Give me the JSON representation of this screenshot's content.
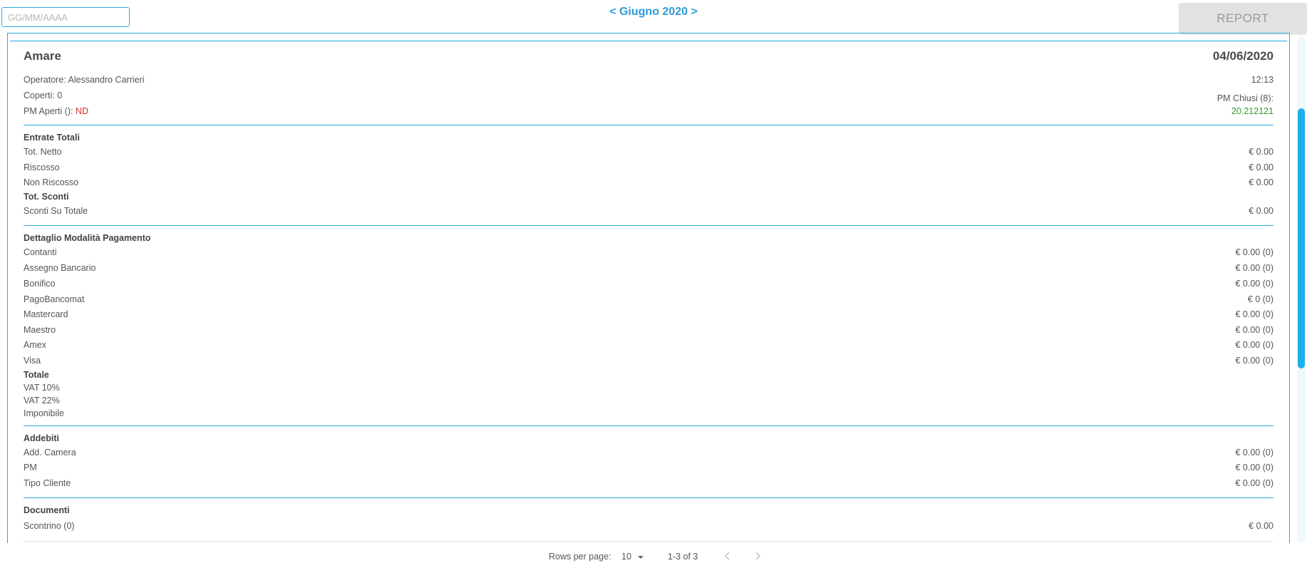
{
  "toolbar": {
    "date_placeholder": "GG/MM/AAAA",
    "month_label": "< Giugno 2020 >",
    "report_label": "REPORT"
  },
  "header": {
    "title": "Amare",
    "date": "04/06/2020",
    "operator_label": "Operatore: Alessandro Carrieri",
    "time": "12:13",
    "covers_label": "Coperti: 0",
    "pm_closed_label": "PM Chiusi (8):",
    "pm_open_label": "PM Aperti ():",
    "pm_open_value": "ND",
    "pm_closed_value": "20.212121"
  },
  "entrate": {
    "title": "Entrate Totali",
    "rows": [
      {
        "label": "Tot. Netto",
        "value": "€ 0.00"
      },
      {
        "label": "Riscosso",
        "value": "€ 0.00"
      },
      {
        "label": "Non Riscosso",
        "value": "€ 0.00"
      }
    ],
    "sconti_title": "Tot. Sconti",
    "sconti_rows": [
      {
        "label": "Sconti Su Totale",
        "value": "€ 0.00"
      }
    ]
  },
  "pagamenti": {
    "title": "Dettaglio Modalità Pagamento",
    "rows": [
      {
        "label": "Contanti",
        "value": "€ 0.00 (0)"
      },
      {
        "label": "Assegno Bancario",
        "value": "€ 0.00 (0)"
      },
      {
        "label": "Bonifico",
        "value": "€ 0.00 (0)"
      },
      {
        "label": "PagoBancomat",
        "value": "€ 0 (0)"
      },
      {
        "label": "Mastercard",
        "value": "€ 0.00 (0)"
      },
      {
        "label": "Maestro",
        "value": "€ 0.00 (0)"
      },
      {
        "label": "Amex",
        "value": "€ 0.00 (0)"
      },
      {
        "label": "Visa",
        "value": "€ 0.00 (0)"
      }
    ],
    "totale_title": "Totale",
    "totale_rows": [
      "VAT 10%",
      "VAT 22%",
      "Imponibile"
    ]
  },
  "addebiti": {
    "title": "Addebiti",
    "rows": [
      {
        "label": "Add. Camera",
        "value": "€ 0.00 (0)"
      },
      {
        "label": "PM",
        "value": "€ 0.00 (0)"
      },
      {
        "label": "Tipo Cliente",
        "value": "€ 0.00 (0)"
      }
    ]
  },
  "documenti": {
    "title": "Documenti",
    "rows": [
      {
        "label": "Scontrino (0)",
        "value": "€ 0.00"
      }
    ]
  },
  "pagination": {
    "rows_per_page_label": "Rows per page:",
    "rows_per_page_value": "10",
    "range_label": "1-3 of 3"
  },
  "colors": {
    "accent": "#29a9e0",
    "negative": "#d32f2f",
    "positive": "#2e9a2e"
  }
}
